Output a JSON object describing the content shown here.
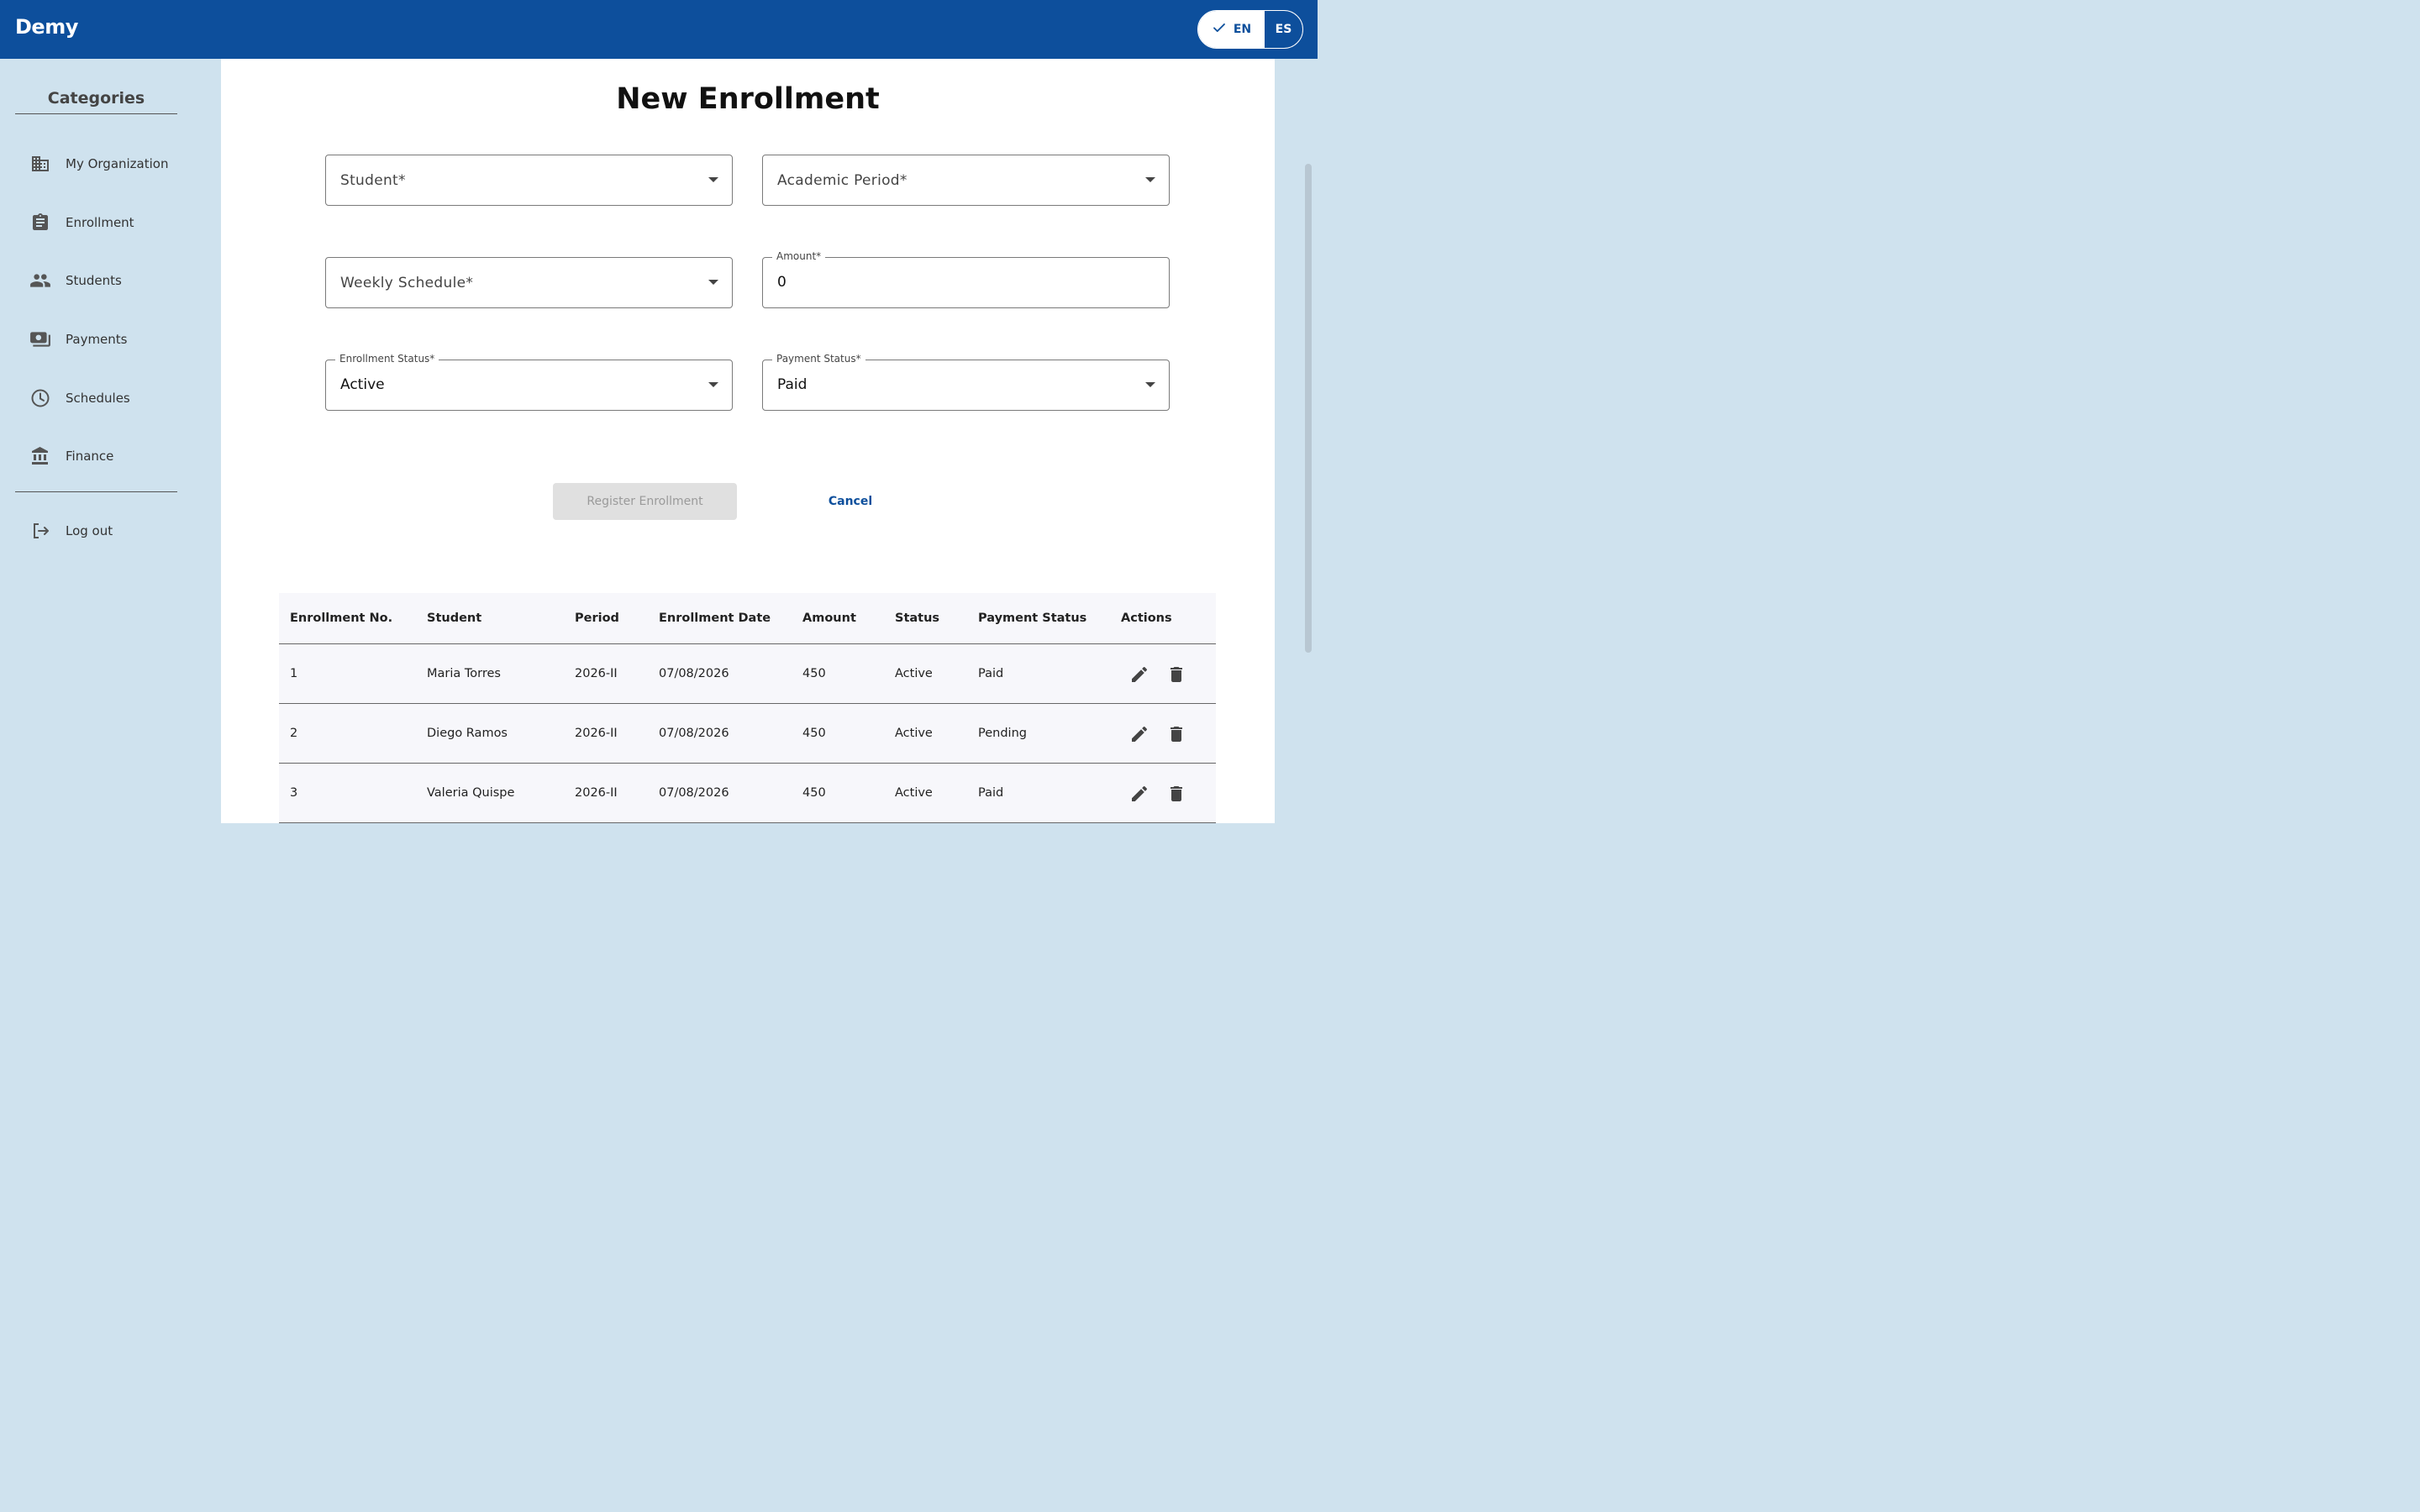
{
  "header": {
    "brand": "Demy",
    "lang_en": "EN",
    "lang_es": "ES"
  },
  "sidebar": {
    "title": "Categories",
    "items": [
      {
        "label": "My Organization",
        "icon": "building-icon"
      },
      {
        "label": "Enrollment",
        "icon": "clipboard-icon"
      },
      {
        "label": "Students",
        "icon": "people-icon"
      },
      {
        "label": "Payments",
        "icon": "payments-icon"
      },
      {
        "label": "Schedules",
        "icon": "clock-icon"
      },
      {
        "label": "Finance",
        "icon": "bank-icon"
      }
    ],
    "logout": {
      "label": "Log out",
      "icon": "logout-icon"
    }
  },
  "form": {
    "title": "New Enrollment",
    "student_placeholder": "Student*",
    "period_placeholder": "Academic Period*",
    "schedule_placeholder": "Weekly Schedule*",
    "amount_label": "Amount*",
    "amount_value": "0",
    "enrollment_status_label": "Enrollment Status*",
    "enrollment_status_value": "Active",
    "payment_status_label": "Payment Status*",
    "payment_status_value": "Paid",
    "register_label": "Register Enrollment",
    "cancel_label": "Cancel"
  },
  "table": {
    "headers": [
      "Enrollment No.",
      "Student",
      "Period",
      "Enrollment Date",
      "Amount",
      "Status",
      "Payment Status",
      "Actions"
    ],
    "rows": [
      [
        "1",
        "Maria Torres",
        "2026-II",
        "07/08/2026",
        "450",
        "Active",
        "Paid"
      ],
      [
        "2",
        "Diego Ramos",
        "2026-II",
        "07/08/2026",
        "450",
        "Active",
        "Pending"
      ],
      [
        "3",
        "Valeria Quispe",
        "2026-II",
        "07/08/2026",
        "450",
        "Active",
        "Paid"
      ]
    ]
  },
  "colors": {
    "primary": "#0d4f9c",
    "sidebar_bg": "#cfe2ee",
    "disabled_button": "#e0e0e0"
  }
}
